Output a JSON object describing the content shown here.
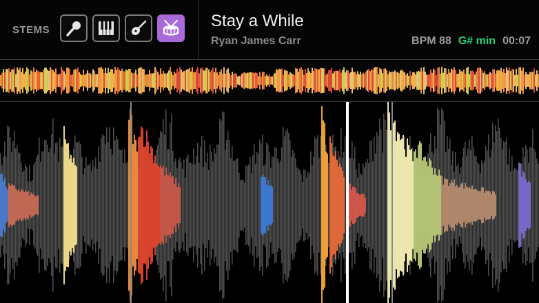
{
  "stems": {
    "label": "STEMS",
    "buttons": [
      {
        "name": "vocals",
        "icon": "microphone-icon",
        "active": false
      },
      {
        "name": "melody",
        "icon": "piano-keys-icon",
        "active": false
      },
      {
        "name": "bass",
        "icon": "guitar-icon",
        "active": false
      },
      {
        "name": "drums",
        "icon": "drum-icon",
        "active": true
      }
    ]
  },
  "track": {
    "title": "Stay a While",
    "artist": "Ryan James Carr",
    "bpm": "BPM 88",
    "key": "G# min",
    "time": "00:07"
  },
  "colors": {
    "accent": "#a86ad8",
    "key": "#2fd17a",
    "playhead": "#ffffff"
  }
}
